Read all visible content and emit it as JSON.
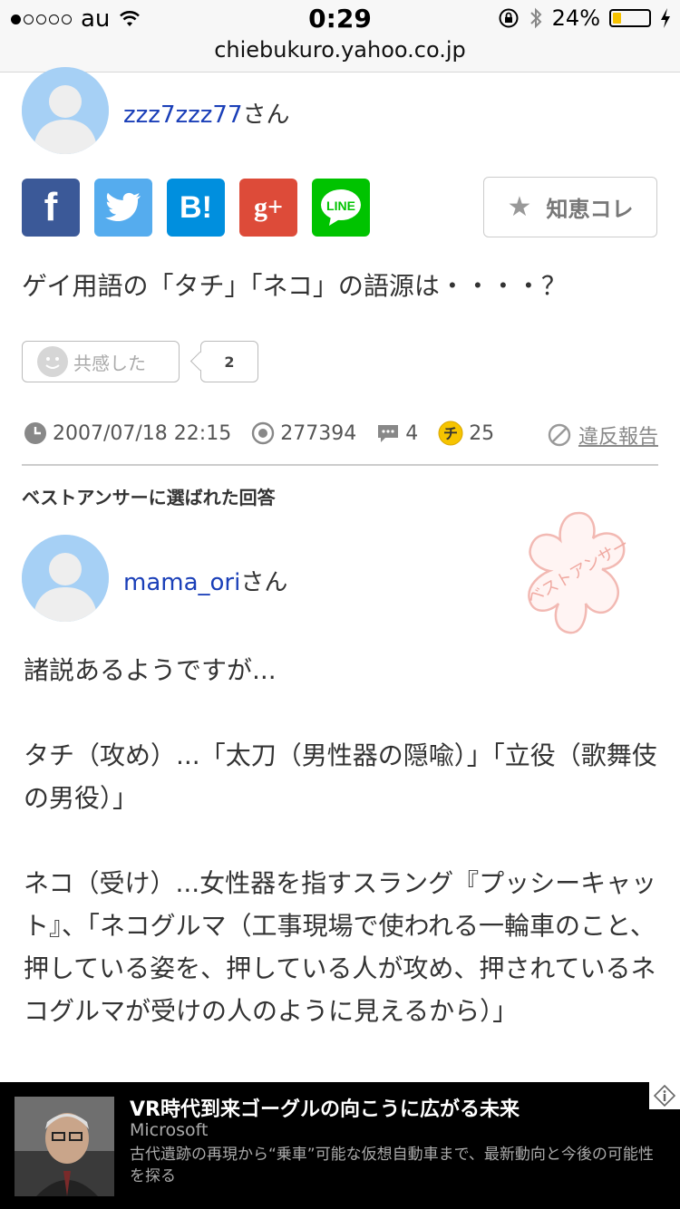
{
  "status_bar": {
    "carrier": "au",
    "signal_dots": [
      true,
      false,
      false,
      false,
      false
    ],
    "time": "0:29",
    "battery_percent": "24%",
    "battery_level": 0.24
  },
  "url_bar": {
    "domain": "chiebukuro.yahoo.co.jp"
  },
  "question": {
    "username": "zzz7zzz77",
    "honorific": "さん",
    "share_buttons": [
      {
        "name": "facebook",
        "label": "f",
        "color": "#3b5998"
      },
      {
        "name": "twitter",
        "icon": "bird-icon",
        "color": "#55acee"
      },
      {
        "name": "hatena",
        "label": "B!",
        "color": "#008fde"
      },
      {
        "name": "googleplus",
        "label": "g+",
        "color": "#dd4b39"
      },
      {
        "name": "line",
        "label": "LINE",
        "color": "#00c300"
      }
    ],
    "chie_kore_label": "知恵コレ",
    "text": "ゲイ用語の「タチ」「ネコ」の語源は・・・・？",
    "empathy_label": "共感した",
    "empathy_count": "2",
    "date": "2007/07/18 22:15",
    "views": "277394",
    "answers": "4",
    "coins": "25",
    "coin_symbol": "チ",
    "report_label": "違反報告"
  },
  "best_answer": {
    "heading": "ベストアンサーに選ばれた回答",
    "username": "mama_ori",
    "honorific": "さん",
    "stamp_text": "ベストアンサー",
    "paragraphs": [
      "諸説あるようですが...",
      "タチ（攻め）...「太刀（男性器の隠喩）」「立役（歌舞伎の男役）」",
      "ネコ（受け）...女性器を指すスラング『プッシーキャット』、「ネコグルマ（工事現場で使われる一輪車のこと、押している姿を、押している人が攻め、押されているネコグルマが受けの人のように見えるから）」"
    ]
  },
  "ad": {
    "title": "VR時代到来ゴーグルの向こうに広がる未来",
    "sponsor": "Microsoft",
    "description": "古代遺跡の再現から“乗車”可能な仮想自動車まで、最新動向と今後の可能性を探る"
  }
}
